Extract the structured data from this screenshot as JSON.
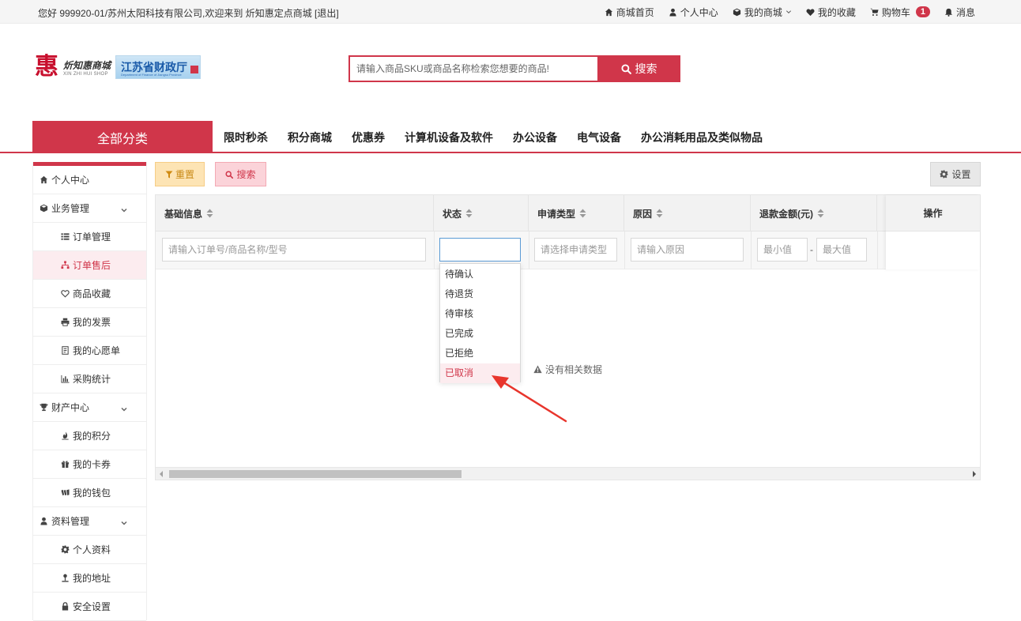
{
  "topbar": {
    "welcome": "您好 999920-01/苏州太阳科技有限公司,欢迎来到 炘知惠定点商城 [退出]",
    "nav": [
      {
        "label": "商城首页",
        "icon": "home-icon"
      },
      {
        "label": "个人中心",
        "icon": "user-icon"
      },
      {
        "label": "我的商城",
        "icon": "cube-icon",
        "dropdown": true
      },
      {
        "label": "我的收藏",
        "icon": "heart-icon"
      },
      {
        "label": "购物车",
        "icon": "cart-icon",
        "badge": "1"
      },
      {
        "label": "消息",
        "icon": "bell-icon"
      }
    ]
  },
  "header": {
    "logo_cn": "炘知惠商城",
    "logo_en": "XIN ZHI HUI SHOP",
    "logo_glyph": "惠",
    "gov_text": "江苏省财政厅",
    "gov_sub": "Department of Finance of Jiangsu Province",
    "search_placeholder": "请输入商品SKU或商品名称检索您想要的商品!",
    "search_button": "搜索"
  },
  "catnav": {
    "all": "全部分类",
    "links": [
      "限时秒杀",
      "积分商城",
      "优惠券",
      "计算机设备及软件",
      "办公设备",
      "电气设备",
      "办公消耗用品及类似物品"
    ]
  },
  "sidebar": {
    "home": "个人中心",
    "business": "业务管理",
    "business_items": [
      "订单管理",
      "订单售后",
      "商品收藏",
      "我的发票",
      "我的心愿单",
      "采购统计"
    ],
    "assets": "财产中心",
    "assets_items": [
      "我的积分",
      "我的卡券",
      "我的钱包"
    ],
    "profile": "资料管理",
    "profile_items": [
      "个人资料",
      "我的地址",
      "安全设置"
    ]
  },
  "toolbar": {
    "reset": "重置",
    "search": "搜索",
    "settings": "设置"
  },
  "table": {
    "headers": [
      "基础信息",
      "状态",
      "申请类型",
      "原因",
      "退款金额(元)",
      "操作"
    ],
    "filters": {
      "basic_placeholder": "请输入订单号/商品名称/型号",
      "status_value": "",
      "type_placeholder": "请选择申请类型",
      "reason_placeholder": "请输入原因",
      "min_placeholder": "最小值",
      "max_placeholder": "最大值",
      "dash": "-"
    },
    "empty": "没有相关数据"
  },
  "dropdown": {
    "options": [
      "待确认",
      "待退货",
      "待审核",
      "已完成",
      "已拒绝",
      "已取消"
    ],
    "hovered_index": 5
  },
  "colors": {
    "accent": "#d0364a",
    "reset_bg": "#fde4b4",
    "search_bg": "#fbd3d9"
  }
}
